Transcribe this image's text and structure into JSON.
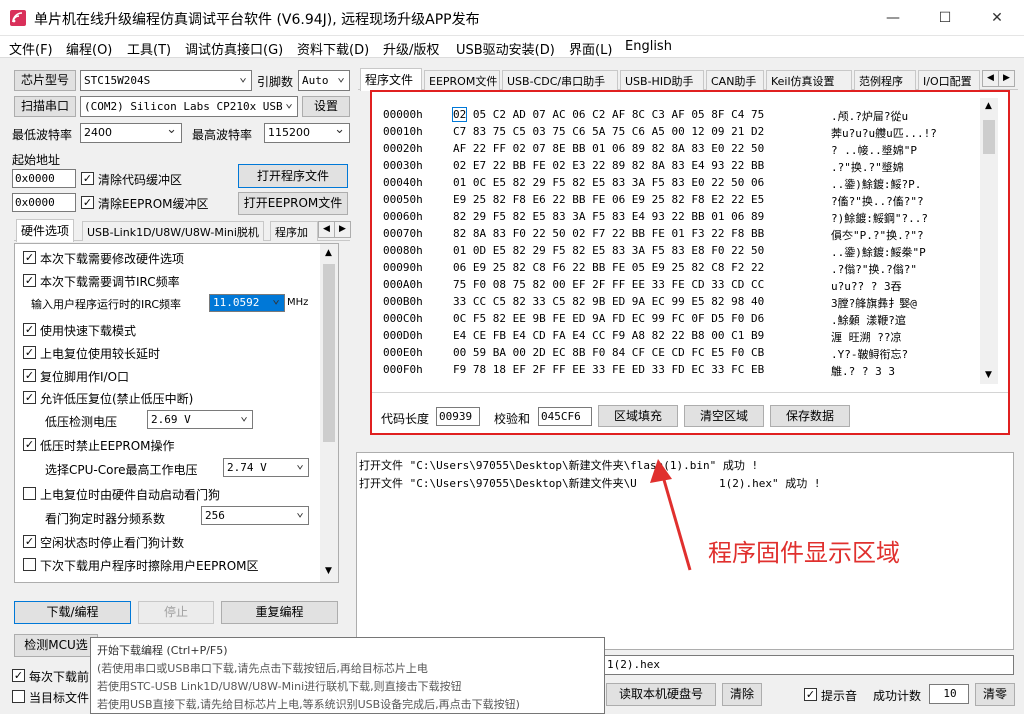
{
  "window": {
    "title": "单片机在线升级编程仿真调试平台软件 (V6.94J), 远程现场升级APP发布",
    "controls": {
      "minimize": "—",
      "maximize": "☐",
      "close": "✕"
    }
  },
  "menu": [
    "文件(F)",
    "编程(O)",
    "工具(T)",
    "调试仿真接口(G)",
    "资料下载(D)",
    "升级/版权",
    "USB驱动安装(D)",
    "界面(L)",
    "English"
  ],
  "left": {
    "chip_btn": "芯片型号",
    "chip_value": "STC15W204S",
    "pins_label": "引脚数",
    "pins_value": "Auto",
    "scan_btn": "扫描串口",
    "port_value": "(COM2) Silicon Labs CP210x USB",
    "settings_btn": "设置",
    "min_baud_label": "最低波特率",
    "min_baud_value": "2400",
    "max_baud_label": "最高波特率",
    "max_baud_value": "115200",
    "start_addr_label": "起始地址",
    "addr1": "0x0000",
    "clear_code": "清除代码缓冲区",
    "open_prog_btn": "打开程序文件",
    "addr2": "0x0000",
    "clear_eeprom": "清除EEPROM缓冲区",
    "open_eeprom_btn": "打开EEPROM文件",
    "tabs": [
      "硬件选项",
      "USB-Link1D/U8W/U8W-Mini脱机",
      "程序加"
    ],
    "options": {
      "o1": "本次下载需要修改硬件选项",
      "o2": "本次下载需要调节IRC频率",
      "irc_label": "输入用户程序运行时的IRC频率",
      "irc_value": "11.0592",
      "irc_unit": "MHz",
      "o3": "使用快速下载模式",
      "o4": "上电复位使用较长延时",
      "o5": "复位脚用作I/O口",
      "o6": "允许低压复位(禁止低压中断)",
      "lvd_label": "低压检测电压",
      "lvd_value": "2.69 V",
      "o7": "低压时禁止EEPROM操作",
      "cpu_label": "选择CPU-Core最高工作电压",
      "cpu_value": "2.74 V",
      "o8": "上电复位时由硬件自动启动看门狗",
      "wdt_label": "看门狗定时器分频系数",
      "wdt_value": "256",
      "o9": "空闲状态时停止看门狗计数",
      "o10": "下次下载用户程序时擦除用户EEPROM区"
    },
    "download_btn": "下载/编程",
    "stop_btn": "停止",
    "repeat_btn": "重复编程",
    "detect_btn": "检测MCU选",
    "each_download": "每次下载前",
    "target_file": "当目标文件"
  },
  "right": {
    "tabs": [
      "程序文件",
      "EEPROM文件",
      "USB-CDC/串口助手",
      "USB-HID助手",
      "CAN助手",
      "Keil仿真设置",
      "范例程序",
      "I/O口配置"
    ],
    "hex_rows": [
      {
        "addr": "00000h",
        "bytes": "02 05 C2 AD 07 AC 06 C2 AF 8C C3 AF 05 8F C4 75",
        "ascii": ".颅.?炉屇?從u"
      },
      {
        "addr": "00010h",
        "bytes": "C7 83 75 C5 03 75 C6 5A 75 C6 A5 00 12 09 21 D2",
        "ascii": "莾u?u?u艭u匹...!?"
      },
      {
        "addr": "00020h",
        "bytes": "AF 22 FF 02 07 8E BB 01 06 89 82 8A 83 E0 22 50",
        "ascii": "?  ..帹..墏婂\"P"
      },
      {
        "addr": "00030h",
        "bytes": "02 E7 22 BB FE 02 E3 22 89 82 8A 83 E4 93 22 BB",
        "ascii": ".?\"换.?\"墏婂"
      },
      {
        "addr": "00040h",
        "bytes": "01 0C E5 82 29 F5 82 E5 83 3A F5 83 E0 22 50 06",
        "ascii": "..鍌)鮽鍍:鮾?P."
      },
      {
        "addr": "00050h",
        "bytes": "E9 25 82 F8 E6 22 BB FE 06 E9 25 82 F8 E2 22 E5",
        "ascii": "?傗?\"换..?傗?\"?"
      },
      {
        "addr": "00060h",
        "bytes": "82 29 F5 82 E5 83 3A F5 83 E4 93 22 BB 01 06 89",
        "ascii": "?)鮽鍍:鮾鋼\"?..?"
      },
      {
        "addr": "00070h",
        "bytes": "82 8A 83 F0 22 50 02 F7 22 BB FE 01 F3 22 F8 BB",
        "ascii": "傊冭\"P.?\"换.?\"?"
      },
      {
        "addr": "00080h",
        "bytes": "01 0D E5 82 29 F5 82 E5 83 3A F5 83 E8 F0 22 50",
        "ascii": "..鍌)鮽鍍:鮾桊\"P"
      },
      {
        "addr": "00090h",
        "bytes": "06 E9 25 82 C8 F6 22 BB FE 05 E9 25 82 C8 F2 22",
        "ascii": ".?傟?\"换.?傟?\""
      },
      {
        "addr": "000A0h",
        "bytes": "75 F0 08 75 82 00 EF 2F FF EE 33 FE CD 33 CD CC",
        "ascii": "u?u??  ? 3吞"
      },
      {
        "addr": "000B0h",
        "bytes": "33 CC C5 82 33 C5 82 9B ED 9A EC 99 E5 82 98 40",
        "ascii": "3膛?艂旗彝扌嫛@"
      },
      {
        "addr": "000C0h",
        "bytes": "0C F5 82 EE 9B FE ED 9A FD EC 99 FC 0F D5 F0 D6",
        "ascii": ".鮽顙  漾鞭?逭"
      },
      {
        "addr": "000D0h",
        "bytes": "E4 CE FB E4 CD FA E4 CC F9 A8 82 22 B8 00 C1 B9",
        "ascii": "湹 旺溯  ??凉"
      },
      {
        "addr": "000E0h",
        "bytes": "00 59 BA 00 2D EC 8B F0 84 CF CE CD FC E5 F0 CB",
        "ascii": ".Y?-鞁鲟衔忘?"
      },
      {
        "addr": "000F0h",
        "bytes": "F9 78 18 EF 2F FF EE 33 FE ED 33 FD EC 33 FC EB",
        "ascii": "鵻.?  ?  3  3"
      }
    ],
    "code_len_label": "代码长度",
    "code_len_value": "00939",
    "checksum_label": "校验和",
    "checksum_value": "045CF6",
    "fill_btn": "区域填充",
    "clear_btn": "清空区域",
    "save_btn": "保存数据",
    "log": [
      "打开文件 \"C:\\Users\\97055\\Desktop\\新建文件夹\\flash(1).bin\" 成功 !",
      "打开文件 \"C:\\Users\\97055\\Desktop\\新建文件夹\\U",
      "1(2).hex\" 成功 !"
    ],
    "annotation": "程序固件显示区域",
    "path_tail": "1(2).hex",
    "read_hdd_btn": "读取本机硬盘号",
    "clear_log_btn": "清除",
    "beep_label": "提示音",
    "success_label": "成功计数",
    "success_value": "10",
    "reset_btn": "清零"
  },
  "tooltip": {
    "title": "开始下载编程 (Ctrl+P/F5)",
    "l1": "(若使用串口或USB串口下载,请先点击下载按钮后,再给目标芯片上电",
    "l2": "若使用STC-USB Link1D/U8W/U8W-Mini进行联机下载,则直接击下载按钮",
    "l3": "若使用USB直接下载,请先给目标芯片上电,等系统识别USB设备完成后,再点击下载按钮)"
  },
  "colors": {
    "annotation": "#e0302e",
    "hex_border": "#e02020",
    "accent": "#0078d7"
  }
}
